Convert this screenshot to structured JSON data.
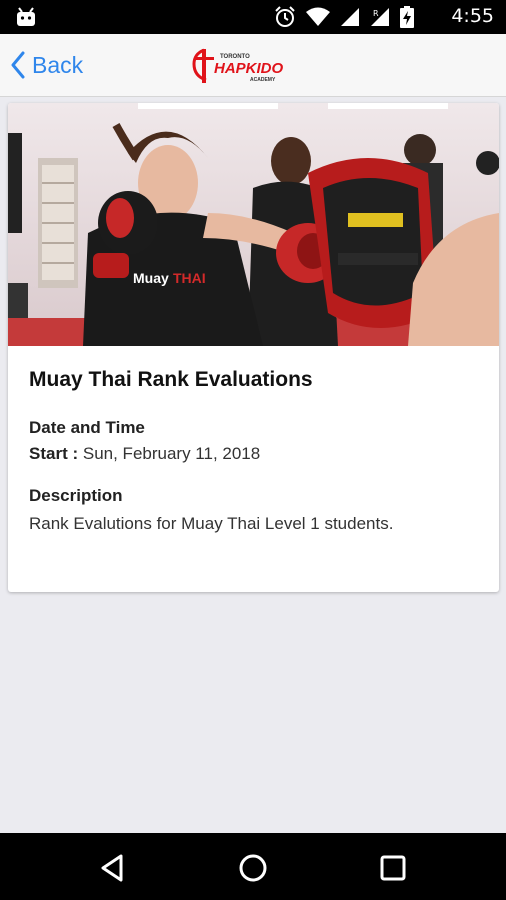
{
  "status_bar": {
    "time": "4:55",
    "icons": [
      "android-icon",
      "alarm-icon",
      "wifi-icon",
      "signal-icon",
      "signal-r-icon",
      "battery-charging-icon"
    ]
  },
  "navbar": {
    "back_label": "Back",
    "logo": {
      "top_text": "TORONTO",
      "main_text": "HAPKIDO",
      "bottom_text": "ACADEMY",
      "brand_color": "#e0131a"
    },
    "accent_color": "#2f86eb"
  },
  "event": {
    "image_alt": "Muay Thai kickboxing training",
    "title": "Muay Thai Rank Evaluations",
    "date_heading": "Date and Time",
    "start_label": "Start :",
    "start_value": "Sun, February 11, 2018",
    "description_heading": "Description",
    "description_text": "Rank Evalutions for Muay Thai Level 1 students."
  },
  "system_nav": {
    "buttons": [
      "back-triangle-icon",
      "home-circle-icon",
      "recents-square-icon"
    ]
  }
}
